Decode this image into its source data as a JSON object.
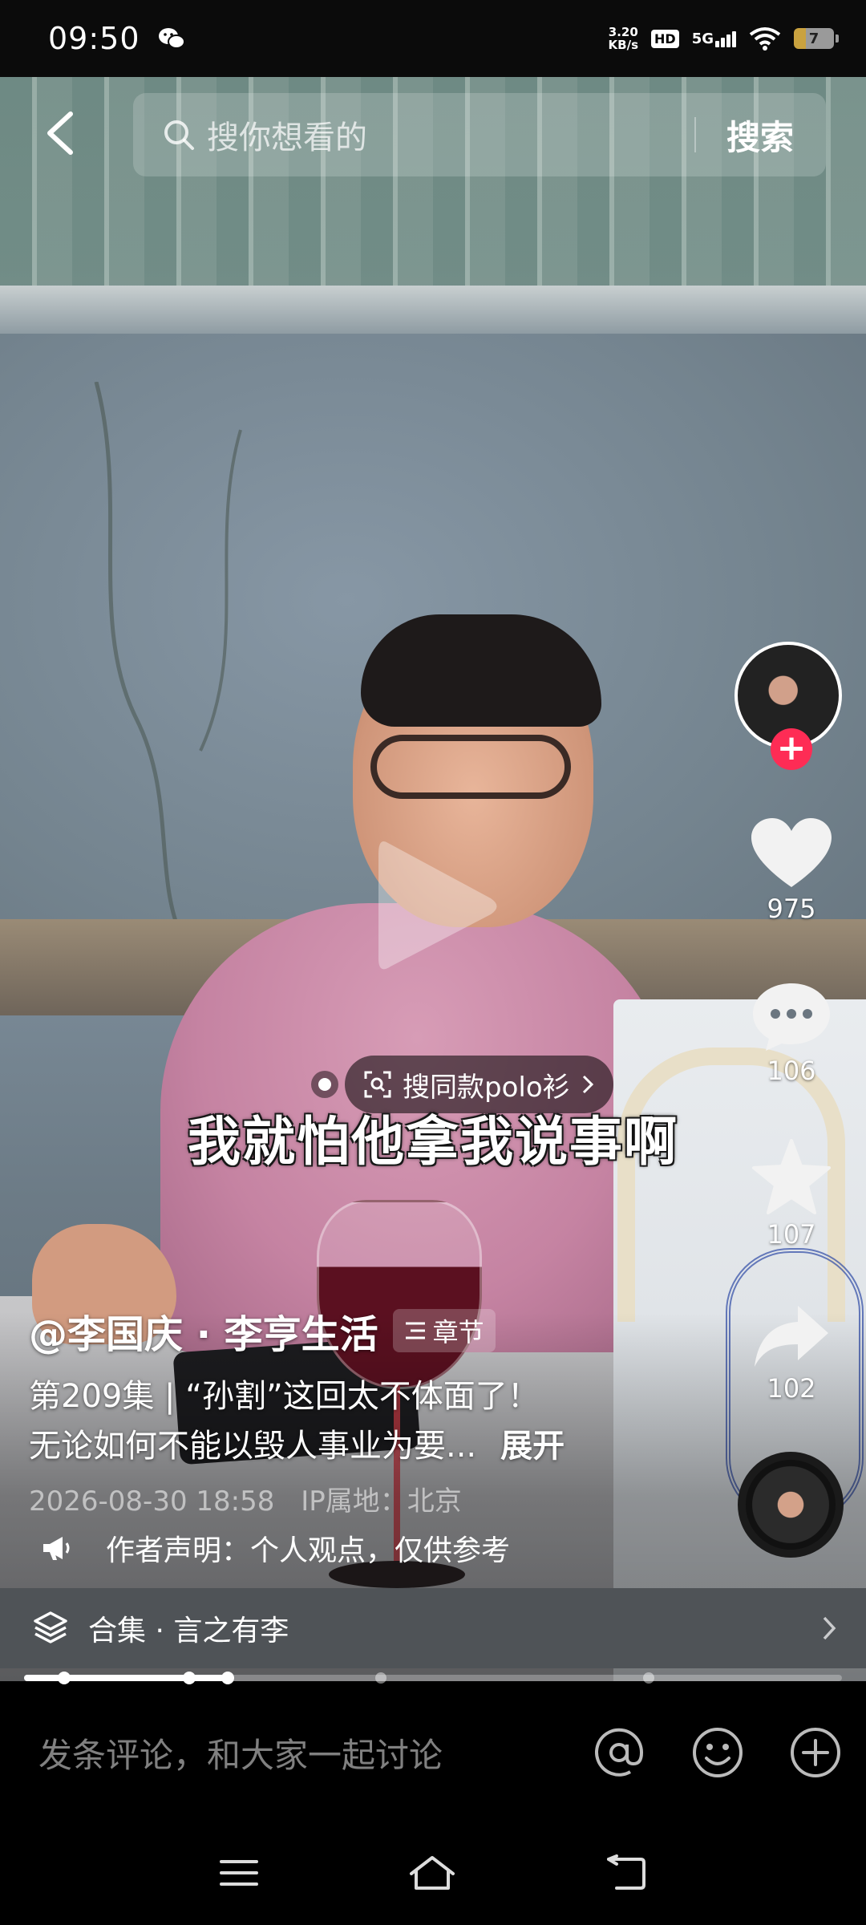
{
  "status_bar": {
    "time": "09:50",
    "net_speed_value": "3.20",
    "net_speed_unit": "KB/s",
    "hd_label": "HD",
    "network_label": "5G",
    "battery_level": "7"
  },
  "search": {
    "placeholder": "搜你想看的",
    "button_label": "搜索"
  },
  "video": {
    "subtitle": "我就怕他拿我说事啊",
    "product_chip_label": "搜同款polo衫"
  },
  "actions": {
    "like_count": "975",
    "comment_count": "106",
    "favorite_count": "107",
    "share_count": "102"
  },
  "author": {
    "name": "@李国庆 · 李亨生活",
    "chapter_label": "章节"
  },
  "description": {
    "line1": "第209集 | “孙割”这回太不体面了！",
    "line2": "无论如何不能以毁人事业为要...",
    "expand_label": "展开"
  },
  "meta": {
    "date": "2026-08-30 18:58",
    "ip_location": "IP属地：北京"
  },
  "declaration": "作者声明：个人观点，仅供参考",
  "collection": {
    "label": "合集 · 言之有李"
  },
  "comment_bar": {
    "placeholder": "发条评论，和大家一起讨论"
  },
  "icons": {
    "back": "chevron-left-icon",
    "search": "search-icon",
    "like": "heart-icon",
    "comment": "comment-bubble-icon",
    "favorite": "star-icon",
    "share": "share-arrow-icon",
    "mention": "at-icon",
    "emoji": "smile-icon",
    "add": "plus-circle-icon",
    "nav_menu": "menu-icon",
    "nav_home": "home-icon",
    "nav_back": "back-icon"
  },
  "colors": {
    "follow_accent": "#fe2c55",
    "collection_bar": "#4f5357"
  }
}
